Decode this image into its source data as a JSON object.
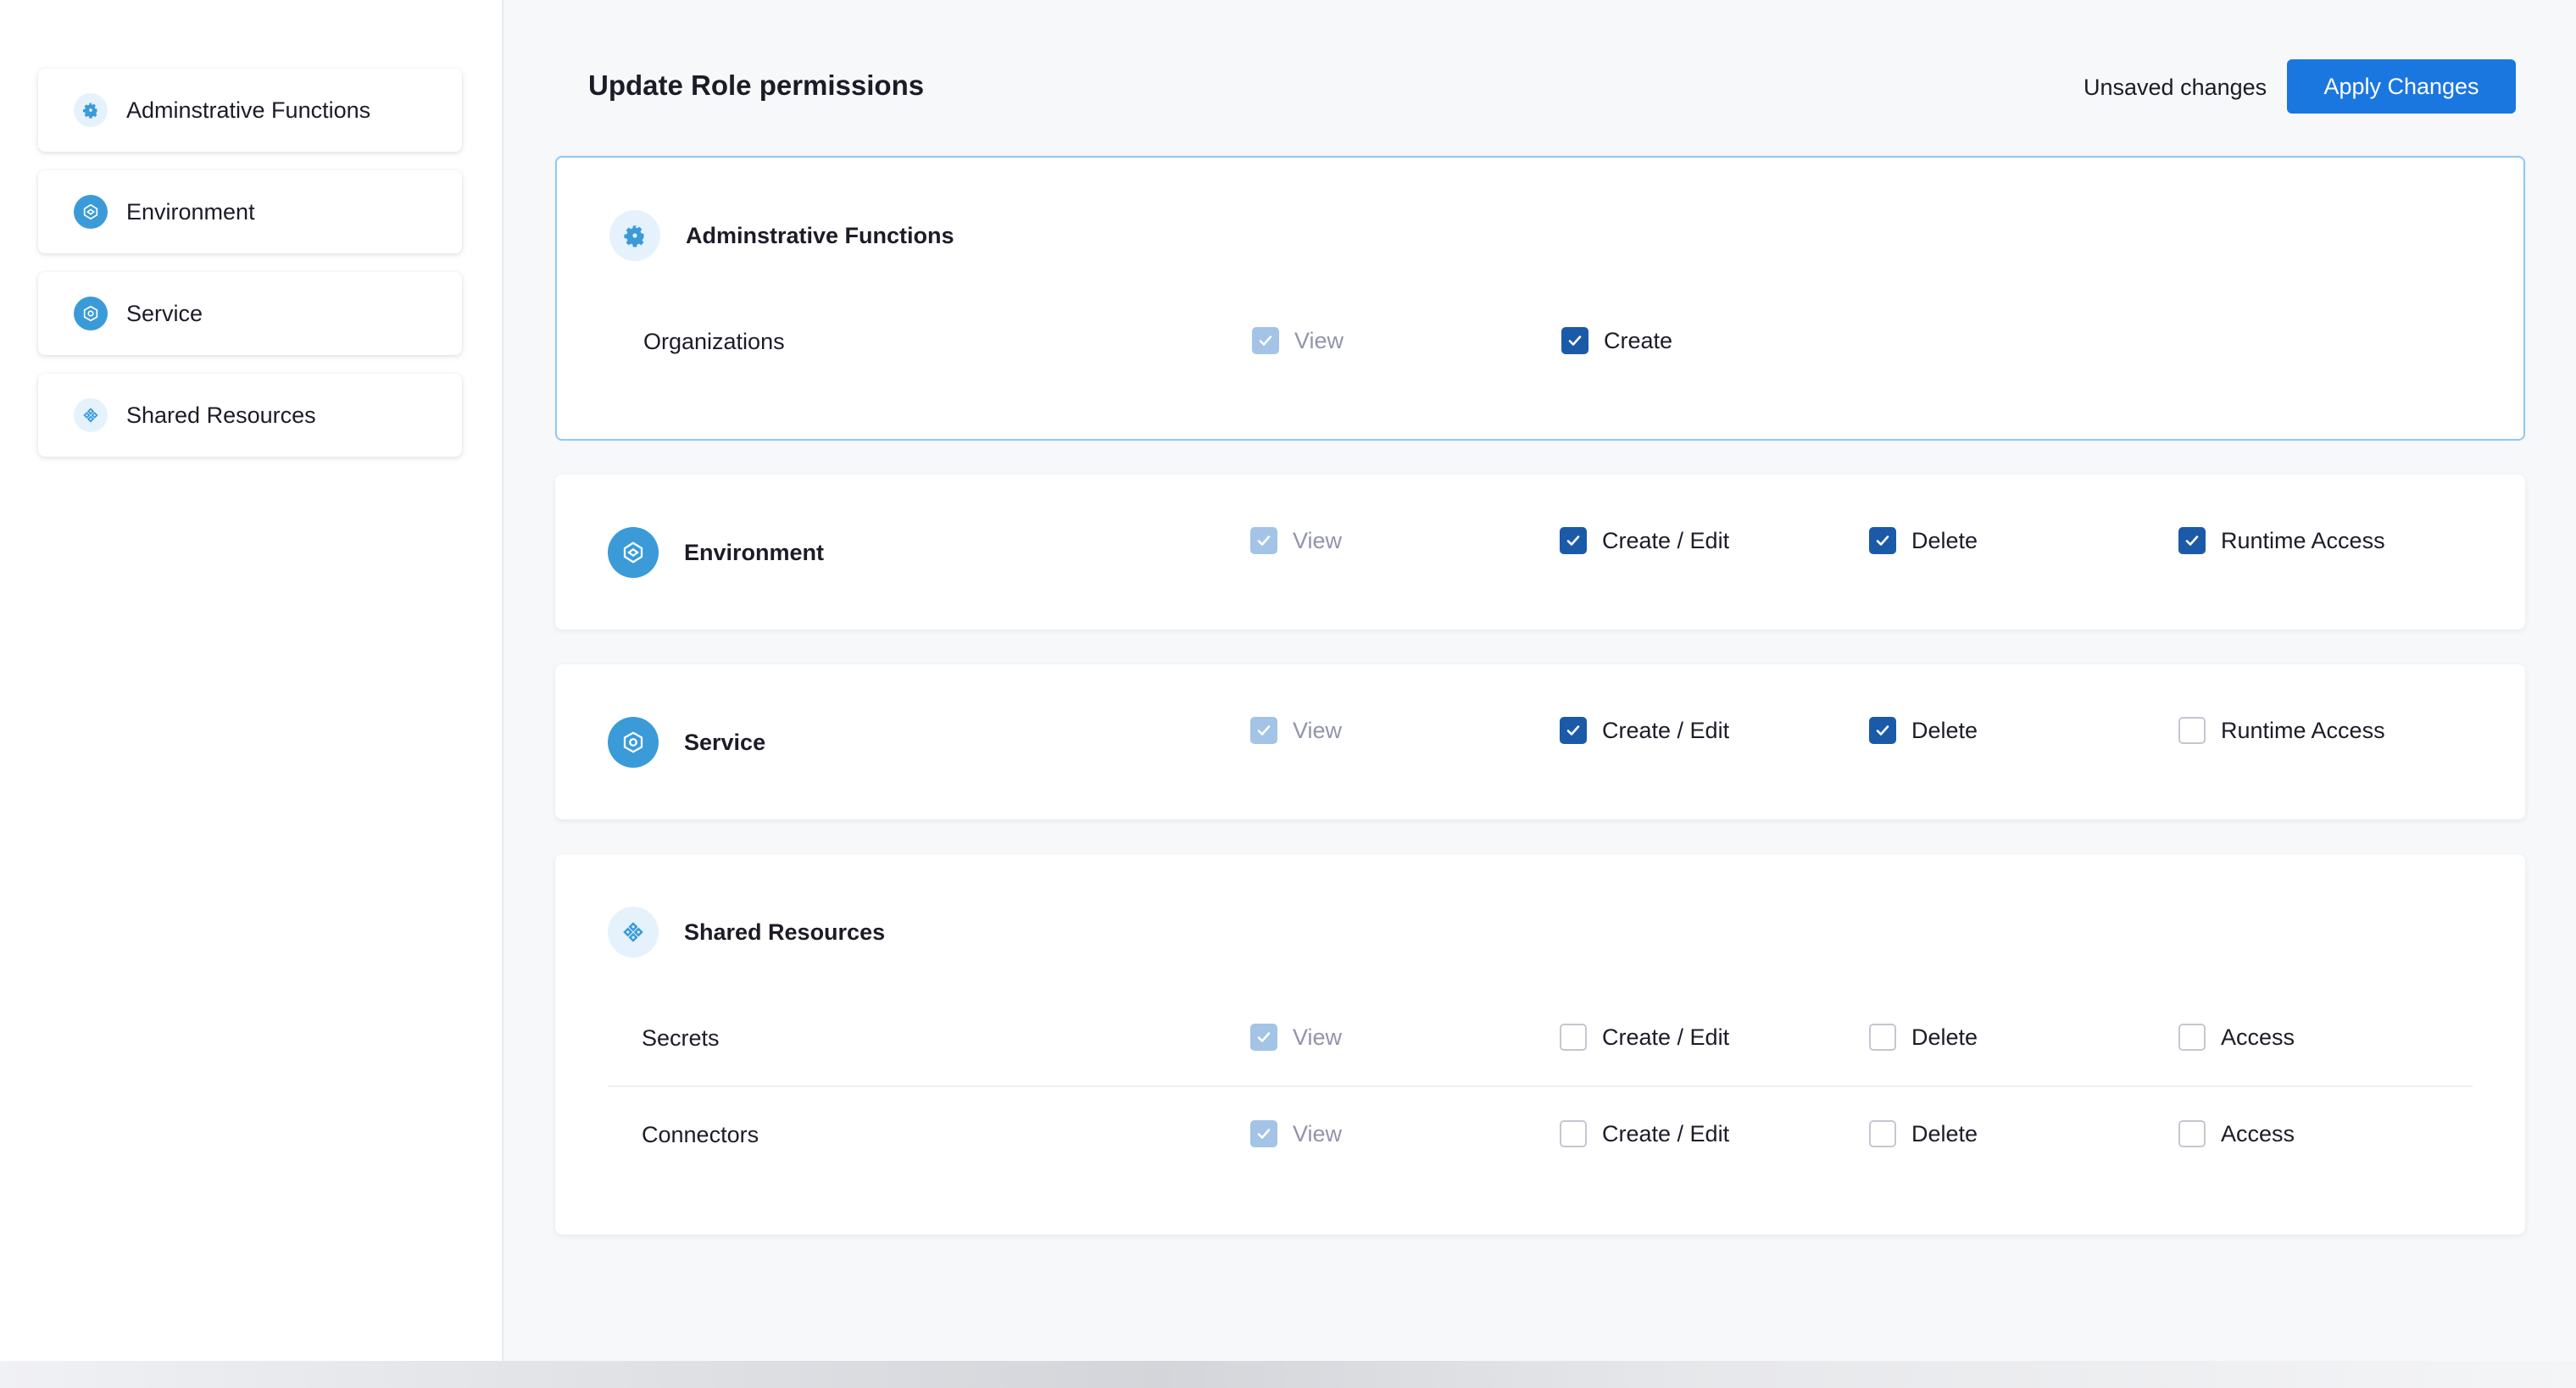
{
  "sidebar": {
    "items": [
      {
        "label": "Adminstrative Functions",
        "icon": "gear-icon"
      },
      {
        "label": "Environment",
        "icon": "environment-icon"
      },
      {
        "label": "Service",
        "icon": "service-icon"
      },
      {
        "label": "Shared Resources",
        "icon": "shared-resources-icon"
      }
    ]
  },
  "header": {
    "title": "Update Role permissions",
    "unsaved_text": "Unsaved changes",
    "apply_label": "Apply Changes"
  },
  "cards": {
    "admin": {
      "title": "Adminstrative Functions",
      "rows": [
        {
          "label": "Organizations",
          "perms": [
            {
              "label": "View",
              "state": "disabled-checked"
            },
            {
              "label": "Create",
              "state": "checked"
            }
          ]
        }
      ]
    },
    "environment": {
      "title": "Environment",
      "perms": [
        {
          "label": "View",
          "state": "disabled-checked"
        },
        {
          "label": "Create / Edit",
          "state": "checked"
        },
        {
          "label": "Delete",
          "state": "checked"
        },
        {
          "label": "Runtime Access",
          "state": "checked"
        }
      ]
    },
    "service": {
      "title": "Service",
      "perms": [
        {
          "label": "View",
          "state": "disabled-checked"
        },
        {
          "label": "Create / Edit",
          "state": "checked"
        },
        {
          "label": "Delete",
          "state": "checked"
        },
        {
          "label": "Runtime Access",
          "state": "unchecked"
        }
      ]
    },
    "shared": {
      "title": "Shared Resources",
      "rows": [
        {
          "label": "Secrets",
          "perms": [
            {
              "label": "View",
              "state": "disabled-checked"
            },
            {
              "label": "Create / Edit",
              "state": "unchecked"
            },
            {
              "label": "Delete",
              "state": "unchecked"
            },
            {
              "label": "Access",
              "state": "unchecked"
            }
          ]
        },
        {
          "label": "Connectors",
          "perms": [
            {
              "label": "View",
              "state": "disabled-checked"
            },
            {
              "label": "Create / Edit",
              "state": "unchecked"
            },
            {
              "label": "Delete",
              "state": "unchecked"
            },
            {
              "label": "Access",
              "state": "unchecked"
            }
          ]
        }
      ]
    }
  },
  "colors": {
    "accent": "#1b77e0",
    "checkbox_checked": "#1b5aa8",
    "checkbox_disabled": "#a3c4e6",
    "icon_blue": "#3a9bd8",
    "icon_light": "#e5f2fc"
  }
}
